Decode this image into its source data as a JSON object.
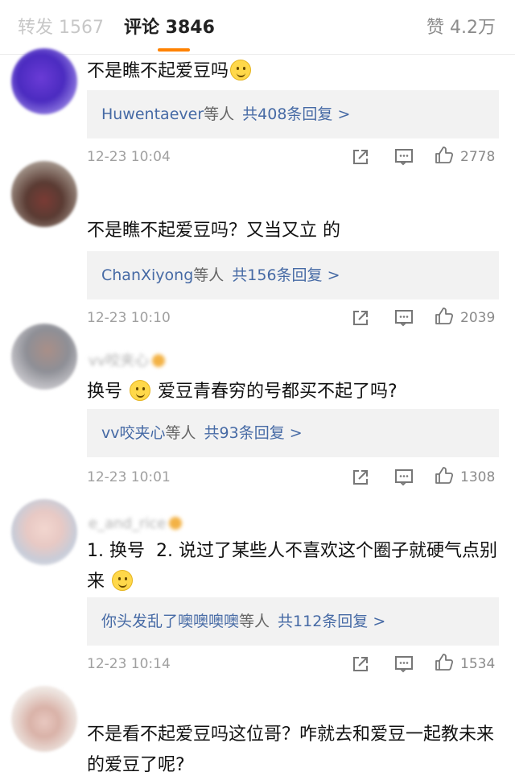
{
  "tabs": {
    "repost": "转发 1567",
    "comments": "评论 3846",
    "likes": "赞 4.2万"
  },
  "colors": {
    "accent": "#ff8200",
    "link": "#466aa5",
    "reply_bg": "#f2f2f2"
  },
  "comments": [
    {
      "username": "",
      "vip": false,
      "text_parts": [
        "不是瞧不起爱豆吗"
      ],
      "emoji": "sweat-smile-emoji",
      "text_after": "",
      "reply_names": "Huwentaever",
      "reply_suffix": "等人",
      "reply_count": "共408条回复 >",
      "time": "12-23 10:04",
      "likes": "2778"
    },
    {
      "username": "",
      "vip": false,
      "text_parts": [
        "不是瞧不起爱豆吗？又当又立 的"
      ],
      "emoji": "",
      "text_after": "",
      "reply_names": "ChanXiyong",
      "reply_suffix": "等人",
      "reply_count": "共156条回复 >",
      "time": "12-23 10:10",
      "likes": "2039"
    },
    {
      "username": "vv咬夹心",
      "vip": true,
      "text_parts": [
        "换号"
      ],
      "emoji": "thinking-emoji",
      "text_after": "爱豆青春穷的号都买不起了吗?",
      "reply_names": "vv咬夹心",
      "reply_suffix": "等人",
      "reply_count": "共93条回复 >",
      "time": "12-23 10:01",
      "likes": "1308"
    },
    {
      "username": "e_and_rice",
      "vip": true,
      "text_parts": [
        "1. 换号  2. 说过了某些人不喜欢这个圈子就硬气点别来"
      ],
      "emoji": "smile-emoji",
      "text_after": "",
      "reply_names": "你头发乱了噢噢噢噢",
      "reply_suffix": "等人",
      "reply_count": "共112条回复 >",
      "time": "12-23 10:14",
      "likes": "1534"
    },
    {
      "username": "",
      "vip": false,
      "text_parts": [
        "不是看不起爱豆吗这位哥？咋就去和爱豆一起教未来的爱豆了呢?"
      ],
      "emoji": "",
      "text_after": ""
    }
  ]
}
